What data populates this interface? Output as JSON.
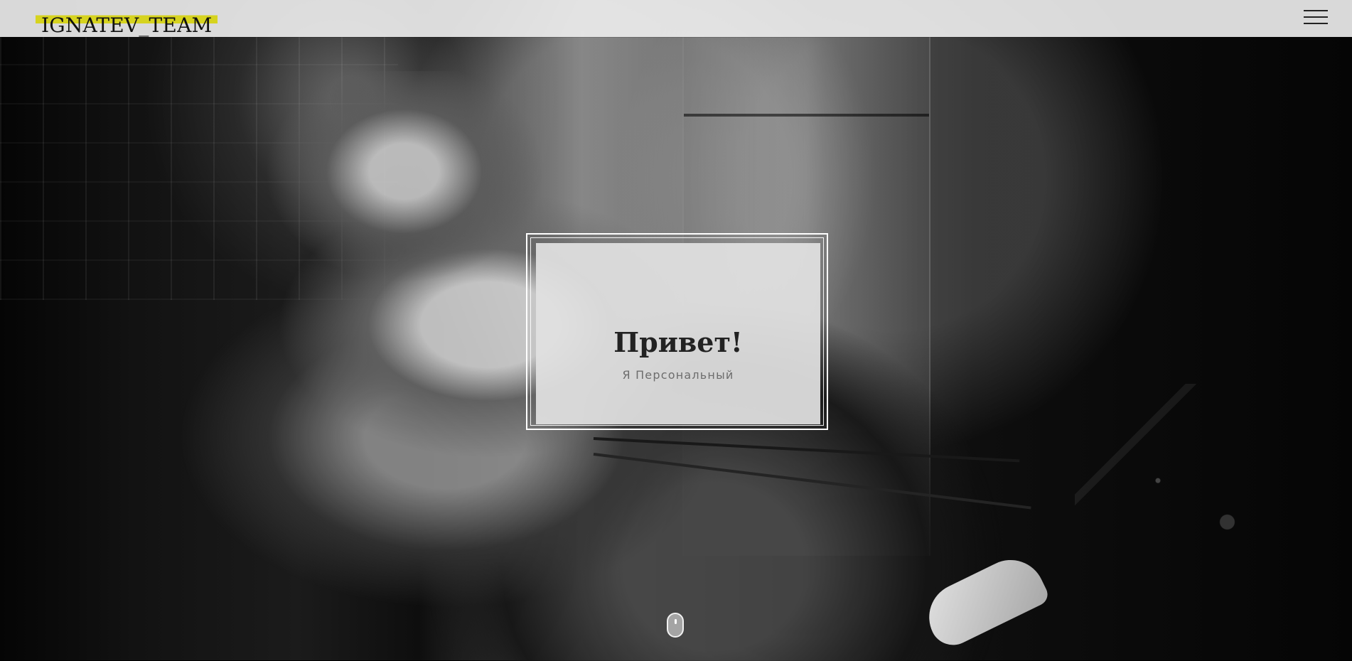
{
  "header": {
    "brand": "IGNATEV_TEAM",
    "menu_icon": "hamburger-menu-icon"
  },
  "hero": {
    "title": "Привет!",
    "subtitle": "Я Персональный",
    "scroll_icon": "mouse-scroll-icon"
  },
  "colors": {
    "brand_highlight": "#d6d31f",
    "header_background": "#ebebeb",
    "card_background": "#e1e1e1"
  }
}
